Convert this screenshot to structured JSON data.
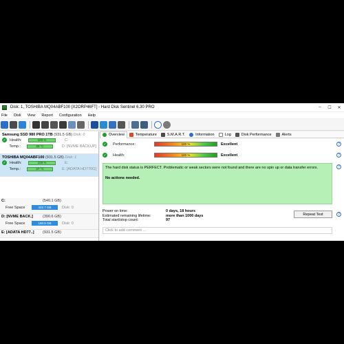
{
  "window": {
    "title": "Disk: 1, TOSHIBA MQ04ABF100 [X2ORP46FT]  -  Hard Disk Sentinel 6.30 PRO",
    "minimize": "–",
    "maximize": "☐",
    "close": "✕"
  },
  "menu": [
    "File",
    "Disk",
    "View",
    "Report",
    "Configuration",
    "Help"
  ],
  "disks": [
    {
      "name": "Samsung SSD 980 PRO 1TB",
      "size": "(931.5 GB)",
      "index": "Disk: 0",
      "health_label": "Health:",
      "health": "100 %",
      "health_fraction": 1.0,
      "temp_label": "Temp.:",
      "temp": "33 °C",
      "drive_letter": "C:",
      "volume": "D: [NVME BACKUP]"
    },
    {
      "name": "TOSHIBA MQ04ABF100",
      "size": "(931.5 GB)",
      "index": "Disk: 1",
      "health_label": "Health:",
      "health": "100 %",
      "health_fraction": 1.0,
      "temp_label": "Temp.:",
      "temp": "27 °C",
      "drive_letter": "E:",
      "volume": "E: [ADATA HD770G]"
    }
  ],
  "volumes": [
    {
      "name": "C:",
      "size": "(540.1 GB)",
      "free_label": "Free Space",
      "free": "422.7 GB",
      "disk": "Disk: 0"
    },
    {
      "name": "D: [NVME BACK.]",
      "size": "(390.6 GB)",
      "free_label": "Free Space",
      "free": "150.5 GB",
      "disk": "Disk: 0"
    },
    {
      "name": "E: [ADATA HD77..]",
      "size": "(931.5 GB)"
    }
  ],
  "tabs": [
    "Overview",
    "Temperature",
    "S.M.A.R.T.",
    "Information",
    "Log",
    "Disk Performance",
    "Alerts"
  ],
  "overview": {
    "performance_label": "Performance:",
    "performance_value": "100 %",
    "performance_fraction": 1.0,
    "performance_rating": "Excellent",
    "health_label": "Health:",
    "health_value": "100 %",
    "health_fraction": 1.0,
    "health_rating": "Excellent",
    "status_text": "The hard disk status is PERFECT. Problematic or weak sectors were not found and there are no spin up or data transfer errors.",
    "actions_text": "No actions needed.",
    "power_on_label": "Power on time:",
    "power_on_value": "0 days, 18 hours",
    "lifetime_label": "Estimated remaining lifetime:",
    "lifetime_value": "more than 1000 days",
    "startstop_label": "Total start/stop count:",
    "startstop_value": "97",
    "repeat_button": "Repeat Test",
    "comment_placeholder": "Click to add comment ..."
  },
  "colors": {
    "status_ok": "#1f9d31",
    "status_box": "#b6f0b6",
    "selected_disk": "#cde6f7",
    "free_space_bar": "#2f8de0"
  }
}
